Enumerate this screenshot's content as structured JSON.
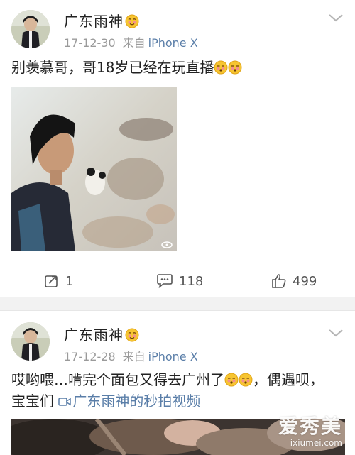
{
  "posts": [
    {
      "username": "广东雨神",
      "date": "17-12-30",
      "from_label": "来自",
      "device": "iPhone X",
      "text": "别羡慕哥，哥18岁已经在玩直播",
      "actions": {
        "repost": "1",
        "comment": "118",
        "like": "499"
      }
    },
    {
      "username": "广东雨神",
      "date": "17-12-28",
      "from_label": "来自",
      "device": "iPhone X",
      "text_line1": "哎哟喂…啃完个面包又得去广州了",
      "text_line1_end": "，偶遇呗，",
      "text_line2": "宝宝们 ",
      "video_link": "广东雨神的秒拍视频"
    }
  ],
  "watermark": {
    "main": "爱秀美",
    "sub": "ixiumei.com"
  },
  "icons": {
    "verified_face": "blushing-face-emoji",
    "chevron": "chevron-down-icon",
    "repost": "repost-icon",
    "comment": "comment-icon",
    "like": "thumbs-up-icon"
  }
}
